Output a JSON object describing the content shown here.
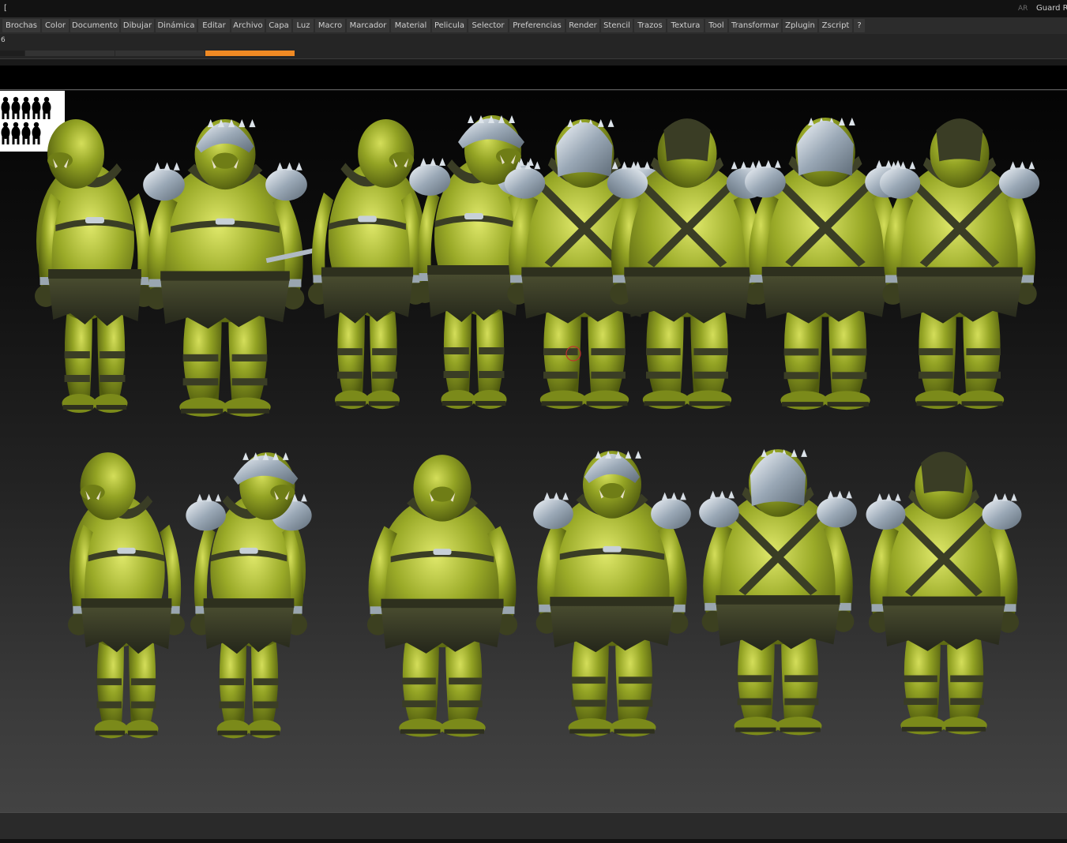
{
  "titlebar": {
    "left_text": "[",
    "ar_label": "AR",
    "right_text": "Guard R"
  },
  "menus": [
    "Brochas",
    "Color",
    "Documento",
    "Dibujar",
    "Dinámica",
    "Editar",
    "Archivo",
    "Capa",
    "Luz",
    "Macro",
    "Marcador",
    "Material",
    "Pelicula",
    "Selector",
    "Preferencias",
    "Render",
    "Stencil",
    "Trazos",
    "Textura",
    "Tool",
    "Transformar",
    "Zplugin",
    "Zscript",
    "?"
  ],
  "tabbar": {
    "number": "6",
    "active_color": "#f08a24"
  },
  "colors": {
    "skin": "#8a9a1f",
    "skin_highlight": "#c4d24a",
    "armor": "#b8c4d0",
    "straps": "#3a3d25"
  }
}
